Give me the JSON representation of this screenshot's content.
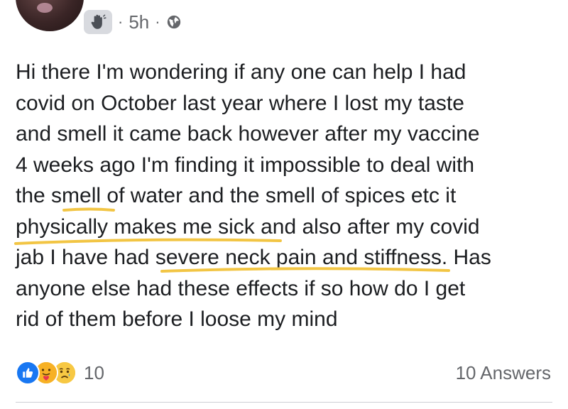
{
  "post": {
    "time": "5h",
    "separator": "·",
    "text_lines": [
      "Hi there I'm wondering if any one can help I had",
      "covid on October last year where I lost my taste",
      "and smell it came back however after my vaccine",
      "4 weeks ago I'm finding it impossible to deal with",
      "the smell of water and the smell of spices etc it",
      "physically makes me sick and also after my covid",
      "jab I have had severe neck pain and stiffness. Has",
      "anyone else had these effects if so how do I get",
      "rid of them before I loose my mind"
    ]
  },
  "reactions": {
    "icons": [
      "like-icon",
      "care-icon",
      "sad-icon"
    ],
    "count": "10"
  },
  "answers_label": "10 Answers",
  "colors": {
    "text": "#1c1e21",
    "secondary_text": "#65676b",
    "highlight_underline": "#f2c544",
    "like_blue": "#1877f2",
    "care_yellow": "#f7b125",
    "sad_yellow": "#f7c843",
    "badge_bg": "#d8dadf",
    "divider": "#ced0d4"
  }
}
